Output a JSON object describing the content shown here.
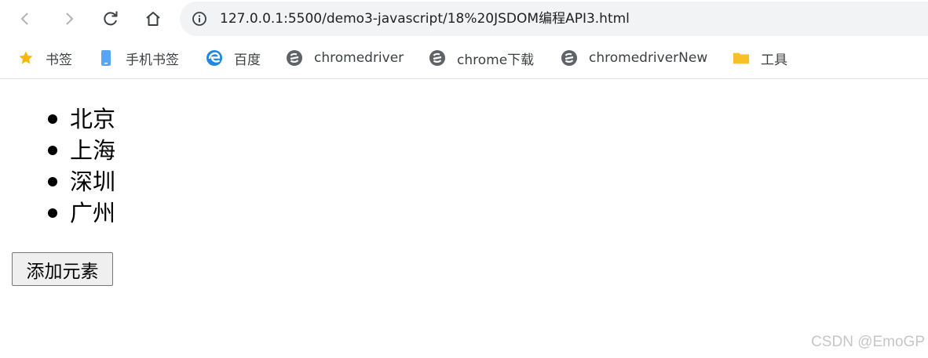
{
  "browser": {
    "url": "127.0.0.1:5500/demo3-javascript/18%20JSDOM编程API3.html",
    "nav_icons": [
      "back-icon",
      "forward-icon",
      "reload-icon",
      "home-icon"
    ]
  },
  "bookmarks": [
    {
      "label": "书签",
      "icon": "star-icon"
    },
    {
      "label": "手机书签",
      "icon": "phone-icon"
    },
    {
      "label": "百度",
      "icon": "edge-icon"
    },
    {
      "label": "chromedriver",
      "icon": "site-icon"
    },
    {
      "label": "chrome下载",
      "icon": "site-icon"
    },
    {
      "label": "chromedriverNew",
      "icon": "site-icon"
    },
    {
      "label": "工具",
      "icon": "folder-icon"
    }
  ],
  "page": {
    "cities": [
      "北京",
      "上海",
      "深圳",
      "广州"
    ],
    "add_button_label": "添加元素"
  },
  "watermark": "CSDN @EmoGP",
  "colors": {
    "star": "#f9b700",
    "folder": "#f6c026",
    "phone": "#5aa4f5",
    "site_icon": "#5f6368",
    "omnibox_bg": "#f1f3f4"
  }
}
